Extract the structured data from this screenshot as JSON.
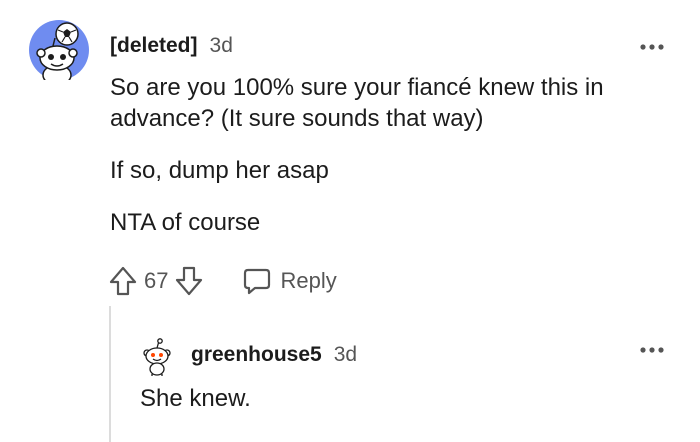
{
  "comment": {
    "author": "[deleted]",
    "time": "3d",
    "paragraphs": [
      "So are you 100% sure your fiancé knew this in advance? (It sure sounds that way)",
      "If so, dump her asap",
      "NTA of course"
    ],
    "score": "67",
    "reply_label": "Reply",
    "avatar_icon": "snoo-avatar-soccer-icon"
  },
  "reply": {
    "author": "greenhouse5",
    "time": "3d",
    "text": "She knew.",
    "avatar_icon": "snoo-avatar-icon"
  },
  "colors": {
    "avatar_bg": "#6f8cf0",
    "text": "#1c1c1c",
    "meta": "#555555",
    "thread_line": "#dcdcdc"
  }
}
